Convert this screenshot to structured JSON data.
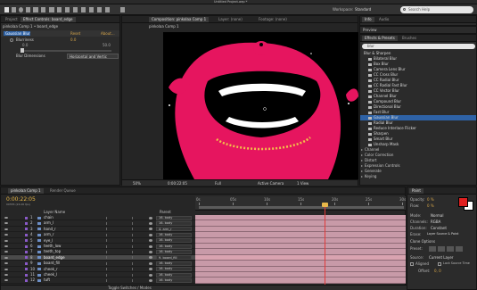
{
  "window": {
    "title": "Untitled Project.aep *"
  },
  "menubar": {
    "workspace_label": "Workspace:",
    "workspace_value": "Standard",
    "search_placeholder": "Search Help"
  },
  "project_panel": {
    "tabs": [
      "Project",
      "Effect Controls: board_edge"
    ],
    "breadcrumb": "pinkolaa Comp 1 • board_edge",
    "effect_name": "Gaussian Blur",
    "reset_label": "Reset",
    "about_label": "About...",
    "blurriness_label": "Blurriness",
    "blurriness_value": "0.0",
    "slider_min": "0.0",
    "slider_max": "50.0",
    "blur_dimensions_label": "Blur Dimensions",
    "blur_dimensions_value": "Horizontal and Vertic"
  },
  "composition": {
    "tabs": [
      "Composition: pinkolaa Comp 1",
      "Layer: (none)",
      "Footage: (none)"
    ],
    "subtab": "pinkolaa Comp 1",
    "zoom": "50%",
    "timecode": "0:00:22:05",
    "resolution": "Full",
    "camera": "Active Camera",
    "view": "1 View"
  },
  "info_panel": {
    "tabs": [
      "Info",
      "Audio"
    ],
    "preview_label": "Preview"
  },
  "effects_panel": {
    "tabs": [
      "Effects & Presets",
      "Brushes"
    ],
    "search_placeholder": "blur",
    "group": "Blur & Sharpen",
    "items": [
      "Bilateral Blur",
      "Box Blur",
      "Camera Lens Blur",
      "CC Cross Blur",
      "CC Radial Blur",
      "CC Radial Fast Blur",
      "CC Vector Blur",
      "Channel Blur",
      "Compound Blur",
      "Directional Blur",
      "Fast Blur",
      "Gaussian Blur",
      "Radial Blur",
      "Reduce Interlace Flicker",
      "Sharpen",
      "Smart Blur",
      "Unsharp Mask"
    ],
    "selected_index": 11,
    "groups_after": [
      "Channel",
      "Color Correction",
      "Distort",
      "Expression Controls",
      "Generate",
      "Keying"
    ]
  },
  "timeline": {
    "tabs": [
      "pinkolaa Comp 1",
      "Render Queue"
    ],
    "timecode": "0:00:22:05",
    "frames_info": "00555 (24.00 fps)",
    "header_layer_name": "Layer Name",
    "header_parent": "Parent",
    "footer_label": "Toggle Switches / Modes",
    "layers": [
      {
        "num": "1",
        "name": "chain",
        "parent": "16. body"
      },
      {
        "num": "2",
        "name": "arm_l",
        "parent": "16. body"
      },
      {
        "num": "3",
        "name": "hand_r",
        "parent": "4. arm_r"
      },
      {
        "num": "4",
        "name": "arm_r",
        "parent": "16. body"
      },
      {
        "num": "5",
        "name": "eye_l",
        "parent": "16. body"
      },
      {
        "num": "6",
        "name": "teeth_low",
        "parent": "16. body"
      },
      {
        "num": "7",
        "name": "teeth_top",
        "parent": "16. body"
      },
      {
        "num": "8",
        "name": "board_edge",
        "parent": "9. board_fill"
      },
      {
        "num": "9",
        "name": "board_fill",
        "parent": "16. body"
      },
      {
        "num": "10",
        "name": "cheek_r",
        "parent": "16. body"
      },
      {
        "num": "11",
        "name": "cheek_l",
        "parent": "16. body"
      },
      {
        "num": "12",
        "name": "tuft",
        "parent": "16. body"
      }
    ],
    "selected_layer_index": 7,
    "ruler_ticks": [
      "0s",
      "05s",
      "10s",
      "15s",
      "20s",
      "25s",
      "30s"
    ]
  },
  "paint_panel": {
    "tabs": [
      "Paint"
    ],
    "opacity_label": "Opacity:",
    "opacity_value": "0 %",
    "flow_label": "Flow:",
    "flow_value": "0 %",
    "mode_label": "Mode:",
    "mode_value": "Normal",
    "channels_label": "Channels:",
    "channels_value": "RGBA",
    "duration_label": "Duration:",
    "duration_value": "Constant",
    "erase_label": "Erase:",
    "erase_value": "Layer Source & Paint",
    "clone_options": "Clone Options",
    "preset_label": "Preset:",
    "source_label": "Source:",
    "source_value": "Current Layer",
    "aligned_label": "Aligned",
    "lock_label": "Lock Source Time",
    "offset_label": "Offset:",
    "offset_value": "0, 0",
    "colors": {
      "foreground": "#e02020",
      "background": "#ffffff"
    }
  }
}
